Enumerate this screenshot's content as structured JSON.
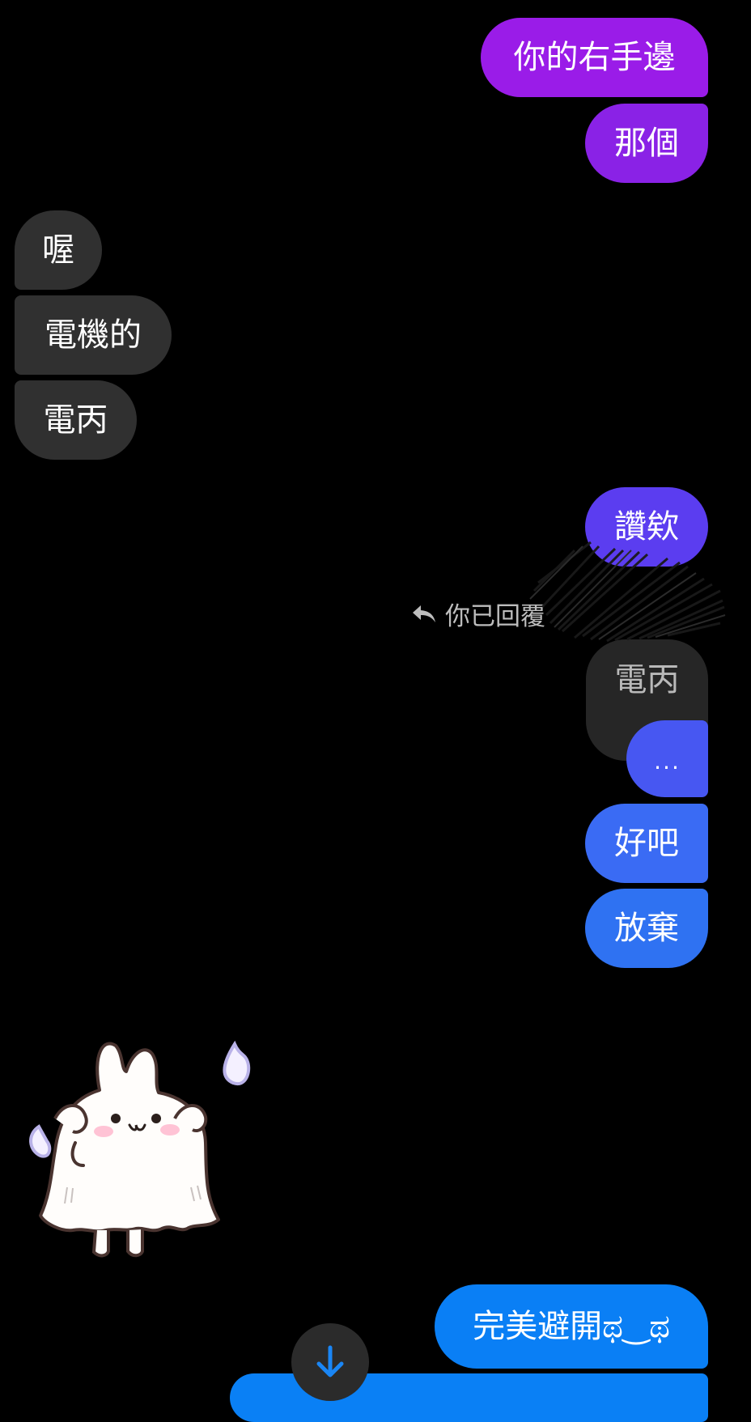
{
  "messages": [
    {
      "text": "你的右手邊"
    },
    {
      "text": "那個"
    },
    {
      "text": "喔"
    },
    {
      "text": "電機的"
    },
    {
      "text": "電丙"
    },
    {
      "text": "讚欸"
    },
    {
      "text": "..."
    },
    {
      "text": "好吧"
    },
    {
      "text": "放棄"
    },
    {
      "text": "完美避開ಥ‿ಥ"
    },
    {
      "text": ""
    }
  ],
  "reply": {
    "indicator_text": "你已回覆",
    "quoted_text": "電丙"
  },
  "colors": {
    "sent_purple": "#9a1ce8",
    "sent_blue": "#0a7ff5",
    "received": "#303030"
  },
  "icons": {
    "reply": "reply-arrow-icon",
    "scroll": "arrow-down-icon",
    "sticker": "ghost-bunny-sticker"
  }
}
